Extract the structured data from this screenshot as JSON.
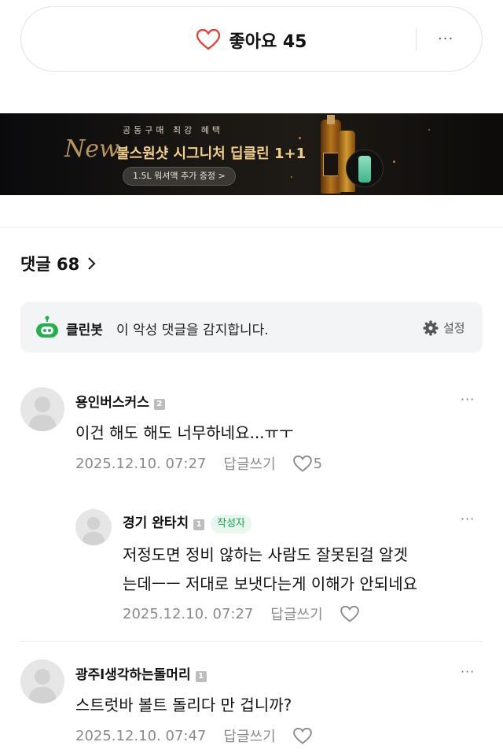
{
  "like_bar": {
    "label": "좋아요 45",
    "more": "···"
  },
  "banner": {
    "subtitle": "공동구매 최강 혜택",
    "new_script": "New",
    "title": "불스원샷 시그니처 딥클린 1+1",
    "pill": "1.5L 워셔액 추가 증정 >"
  },
  "comments_header": {
    "label": "댓글 68"
  },
  "cleanbot": {
    "name": "클린봇",
    "text": "이 악성 댓글을 감지합니다.",
    "setting": "설정"
  },
  "comments": [
    {
      "author": "용인버스커스",
      "level": "2",
      "body_lines": [
        "이건 해도 해도 너무하네요...ㅠㅜ"
      ],
      "date": "2025.12.10. 07:27",
      "reply": "답글쓰기",
      "likes": "5",
      "more": "···"
    },
    {
      "author": "경기 완타치",
      "level": "1",
      "badge": "작성자",
      "body_lines": [
        "저정도면 정비 않하는 사람도 잘못된걸 알겟",
        "는데ㅡㅡ 저대로 보냇다는게 이해가 안되네요"
      ],
      "date": "2025.12.10. 07:27",
      "reply": "답글쓰기",
      "likes": "",
      "more": "···"
    },
    {
      "author": "광주l생각하는돌머리",
      "level": "1",
      "body_lines": [
        "스트럿바 볼트 돌리다 만 겁니까?"
      ],
      "date": "2025.12.10. 07:47",
      "reply": "답글쓰기",
      "likes": "",
      "more": "···"
    }
  ],
  "colors": {
    "heart": "#e0453a",
    "author_badge": "#16a34a",
    "cleanbot_green": "#22b14c"
  }
}
